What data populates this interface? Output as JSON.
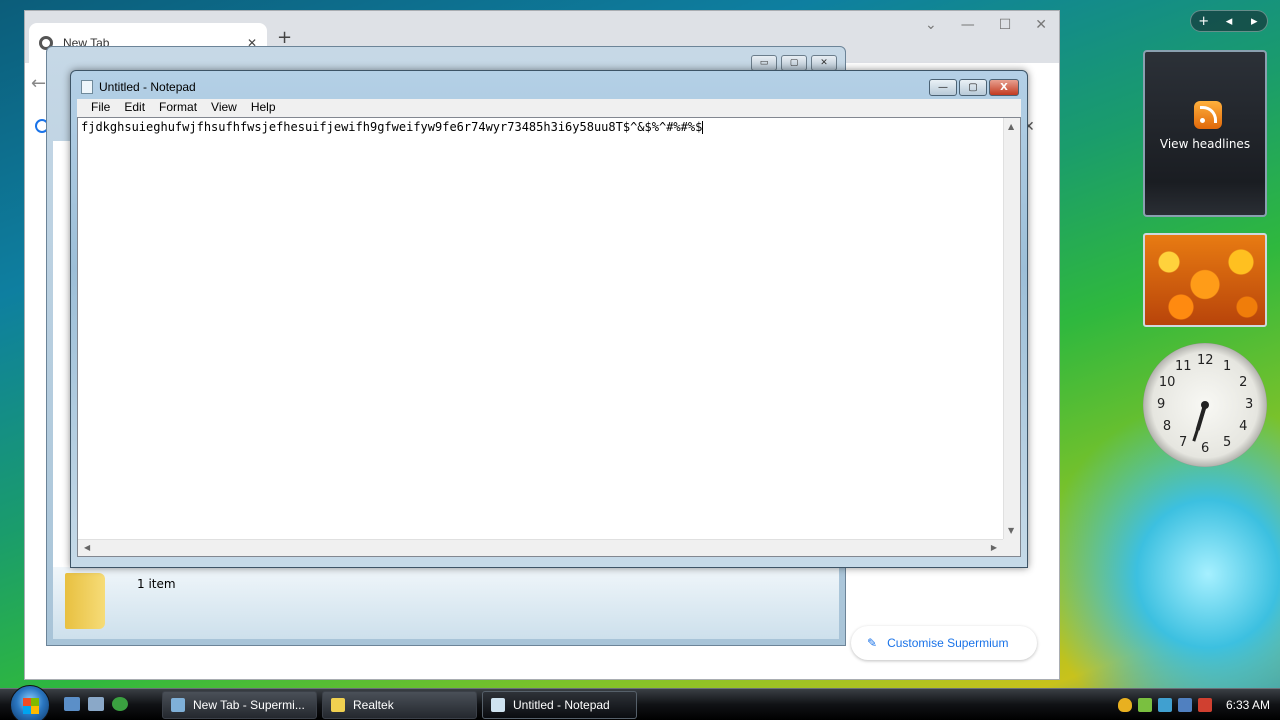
{
  "browser": {
    "tab_title": "New Tab",
    "new_tab": "+",
    "tab_close": "✕",
    "win_min": "—",
    "win_max": "☐",
    "win_close": "✕",
    "win_down": "⌄",
    "back": "←",
    "close_x": "✕",
    "customise_label": "Customise Supermium",
    "customise_icon": "✎"
  },
  "explorer": {
    "item_count": "1 item",
    "ctrl_min": "▭",
    "ctrl_max": "▢",
    "ctrl_close": "✕"
  },
  "notepad": {
    "title": "Untitled - Notepad",
    "menu": [
      "File",
      "Edit",
      "Format",
      "View",
      "Help"
    ],
    "content": "fjdkghsuieghufwjfhsufhfwsjefhesuifjewifh9gfweifyw9fe6r74wyr73485h3i6y58uu8T$^&$%^#%#%$",
    "ctrl_min": "—",
    "ctrl_max": "▢",
    "ctrl_close": "X"
  },
  "sidebar": {
    "top_buttons": [
      "+",
      "◂",
      "▸"
    ],
    "feed_label": "View headlines",
    "clock_numbers": [
      "12",
      "1",
      "2",
      "3",
      "4",
      "5",
      "6",
      "7",
      "8",
      "9",
      "10",
      "11"
    ],
    "clock_time": "6:33"
  },
  "taskbar": {
    "tasks": [
      {
        "label": "New Tab - Supermi...",
        "icon_color": "#7fb0d8"
      },
      {
        "label": "Realtek",
        "icon_color": "#f0d050"
      },
      {
        "label": "Untitled - Notepad",
        "icon_color": "#cfe3f0"
      }
    ],
    "clock": "6:33 AM"
  }
}
